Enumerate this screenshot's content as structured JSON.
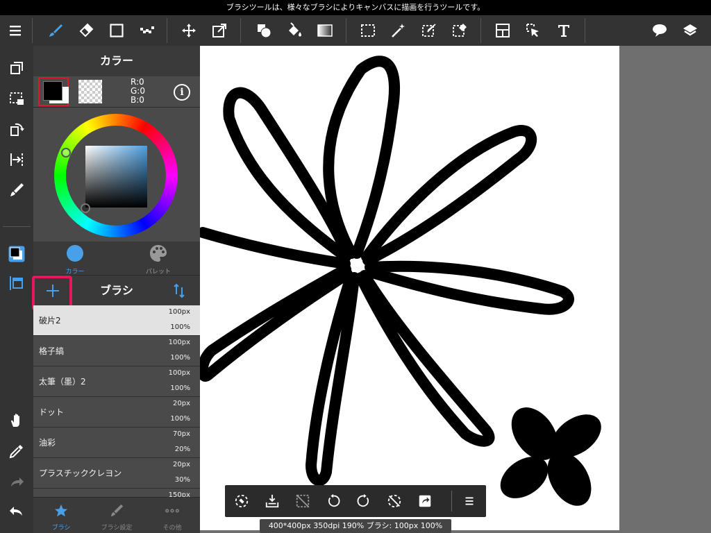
{
  "status_bar": {
    "hint": "ブラシツールは、様々なブラシによりキャンバスに描画を行うツールです。"
  },
  "color_panel": {
    "title": "カラー",
    "rgb": {
      "r": "R:0",
      "g": "G:0",
      "b": "B:0"
    },
    "info_label": "i",
    "primary_color": "#000000",
    "secondary_color": "#ffffff",
    "tabs": [
      {
        "label": "カラー",
        "active": true
      },
      {
        "label": "パレット",
        "active": false
      }
    ]
  },
  "brush_panel": {
    "title": "ブラシ",
    "items": [
      {
        "name": "破片2",
        "size": "100px",
        "opacity": "100%",
        "selected": true
      },
      {
        "name": "格子縞",
        "size": "100px",
        "opacity": "100%"
      },
      {
        "name": "太筆（墨）2",
        "size": "100px",
        "opacity": "100%"
      },
      {
        "name": "ドット",
        "size": "20px",
        "opacity": "100%"
      },
      {
        "name": "油彩",
        "size": "70px",
        "opacity": "20%"
      },
      {
        "name": "プラスチッククレヨン",
        "size": "20px",
        "opacity": "30%"
      },
      {
        "name": "",
        "size": "150px",
        "opacity": ""
      }
    ]
  },
  "bottom_tabs": [
    {
      "label": "ブラシ",
      "active": true
    },
    {
      "label": "ブラシ設定",
      "active": false
    },
    {
      "label": "その他",
      "active": false
    }
  ],
  "canvas_status": "400*400px 350dpi 190% ブラシ: 100px 100%",
  "accent_color": "#4aa0e8",
  "highlight_color": "#e8165c"
}
